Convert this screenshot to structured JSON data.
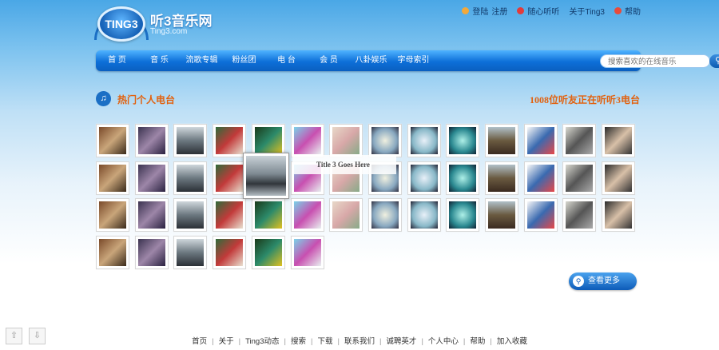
{
  "brand": {
    "badge": "TING3",
    "name_cn": "听3音乐网",
    "name_en": "Ting3.com"
  },
  "toplinks": {
    "login": "登陆",
    "register": "注册",
    "random": "随心听听",
    "about": "关于Ting3",
    "help": "帮助"
  },
  "nav": {
    "items": [
      "首 页",
      "音 乐",
      "流歌专辑",
      "粉丝团",
      "电 台",
      "会 员",
      "八卦娱乐",
      "字母索引"
    ]
  },
  "search": {
    "placeholder": "搜索喜欢的在线音乐"
  },
  "section": {
    "title": "热门个人电台",
    "listeners": "1008位听友正在听听3电台"
  },
  "hover": {
    "title": "Title 3 Goes Here"
  },
  "more_button": "查看更多",
  "footer": {
    "links": [
      "首页",
      "关于",
      "Ting3动态",
      "搜索",
      "下载",
      "联系我们",
      "诚聘英才",
      "个人中心",
      "帮助",
      "加入收藏"
    ]
  },
  "colors": {
    "accent_orange": "#e2610e",
    "nav_blue": "#0d6fd8",
    "brand_blue": "#1b6fc5"
  },
  "icons": [
    "headphones-icon",
    "home-icon",
    "heart-icon",
    "help-icon",
    "search-icon",
    "scroll-up-icon",
    "scroll-down-icon"
  ]
}
